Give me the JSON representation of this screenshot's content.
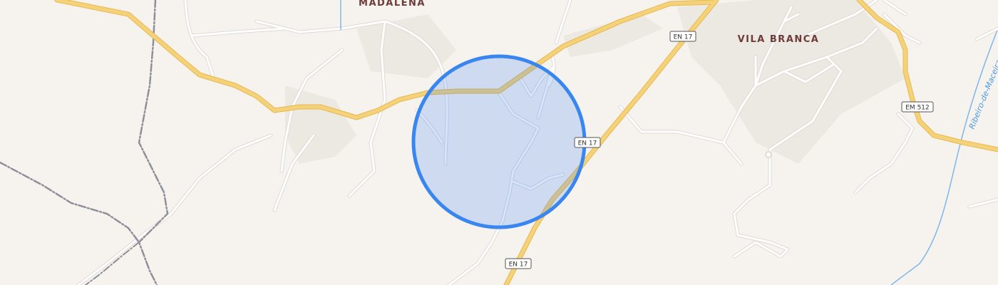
{
  "map": {
    "place_labels": {
      "madalena": "MADALENA",
      "vila_branca": "VILA BRANCA"
    },
    "road_shields": {
      "en17_top": "EN 17",
      "en17_mid": "EN 17",
      "en17_bottom": "EN 17",
      "em512": "EM 512"
    },
    "water_label": "Ribeiro-de-Maceira",
    "colors": {
      "background": "#f6f3ef",
      "main_road": "#f5d27a",
      "main_road_casing": "#e6b94f",
      "minor_road": "#ffffff",
      "minor_road_casing": "#dedad4",
      "railway": "#8f8f9a",
      "water": "#7fb6ea",
      "built_area": "#ece8e2",
      "location_fill": "#cfdcf1",
      "location_stroke": "#3a86f0",
      "place_label": "#6e3b3b"
    },
    "icons": {
      "location_marker": "accuracy-circle-icon"
    }
  }
}
